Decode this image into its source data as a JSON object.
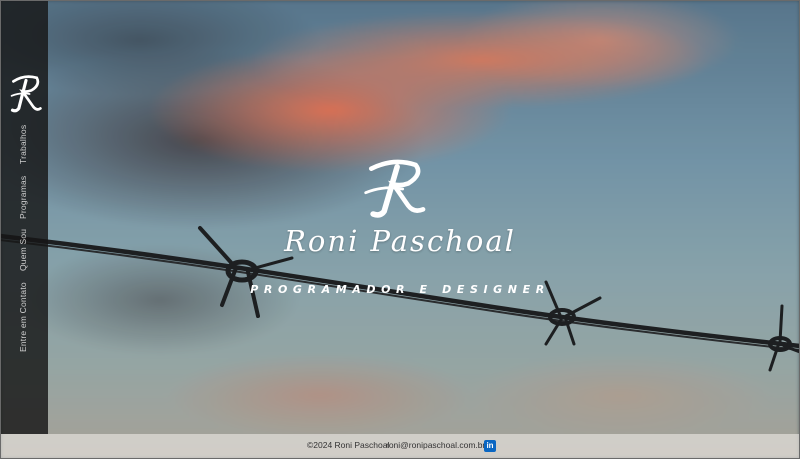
{
  "brand": {
    "monogram": "R",
    "name": "Roni Paschoal",
    "tagline": "PROGRAMADOR E DESIGNER"
  },
  "sidebar": {
    "items": [
      {
        "label": "Trabalhos"
      },
      {
        "label": "Programas"
      },
      {
        "label": "Quem Sou"
      },
      {
        "label": "Entre em Contato"
      }
    ]
  },
  "footer": {
    "copyright": "©2024 Roni Paschoal",
    "email": "roni@ronipaschoal.com.br",
    "linkedin_icon": "in"
  },
  "colors": {
    "sidebar_bg": "#161616",
    "footer_bg": "#ece9e5",
    "linkedin": "#0a66c2",
    "text_light": "#ffffff"
  }
}
